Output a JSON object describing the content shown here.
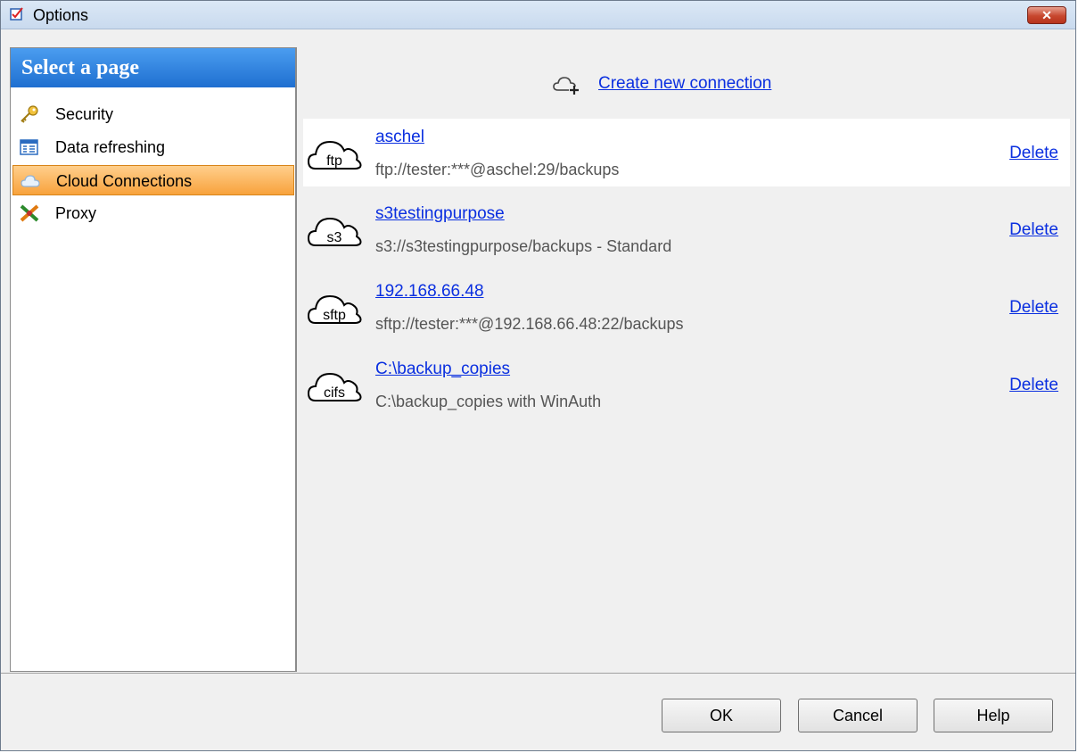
{
  "window": {
    "title": "Options",
    "close_glyph": "✕"
  },
  "sidebar": {
    "header": "Select a page",
    "items": [
      {
        "label": "Security",
        "icon": "key-icon"
      },
      {
        "label": "Data refreshing",
        "icon": "table-icon"
      },
      {
        "label": "Cloud Connections",
        "icon": "cloud-icon",
        "active": true
      },
      {
        "label": "Proxy",
        "icon": "plug-icon"
      }
    ]
  },
  "main": {
    "create_link": "Create new connection",
    "connections": [
      {
        "protocol": "ftp",
        "name": "aschel",
        "detail": "ftp://tester:***@aschel:29/backups",
        "delete": "Delete",
        "selected": true
      },
      {
        "protocol": "s3",
        "name": "s3testingpurpose",
        "detail": "s3://s3testingpurpose/backups - Standard",
        "delete": "Delete"
      },
      {
        "protocol": "sftp",
        "name": "192.168.66.48",
        "detail": "sftp://tester:***@192.168.66.48:22/backups",
        "delete": "Delete"
      },
      {
        "protocol": "cifs",
        "name": "C:\\backup_copies",
        "detail": "C:\\backup_copies with WinAuth",
        "delete": "Delete"
      }
    ]
  },
  "footer": {
    "ok": "OK",
    "cancel": "Cancel",
    "help": "Help"
  },
  "colors": {
    "link": "#0a2fe0",
    "header_blue": "#1f6fd0",
    "active_orange": "#f8a23c"
  }
}
